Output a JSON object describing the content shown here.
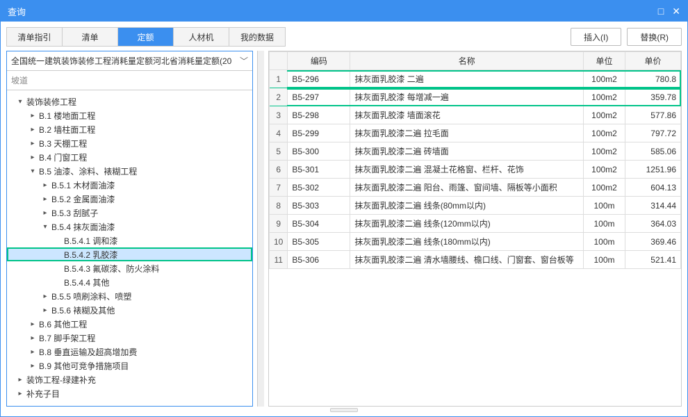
{
  "window": {
    "title": "查询"
  },
  "tabs": [
    "清单指引",
    "清单",
    "定额",
    "人材机",
    "我的数据"
  ],
  "active_tab": 2,
  "buttons": {
    "insert": "插入(I)",
    "replace": "替换(R)"
  },
  "selector": {
    "text": "全国统一建筑装饰装修工程消耗量定额河北省消耗量定额(20"
  },
  "search": {
    "placeholder": "坡道"
  },
  "tree": [
    {
      "depth": 0,
      "toggle": "▾",
      "label": "装饰装修工程"
    },
    {
      "depth": 1,
      "toggle": "▸",
      "label": "B.1 楼地面工程"
    },
    {
      "depth": 1,
      "toggle": "▸",
      "label": "B.2 墙柱面工程"
    },
    {
      "depth": 1,
      "toggle": "▸",
      "label": "B.3 天棚工程"
    },
    {
      "depth": 1,
      "toggle": "▸",
      "label": "B.4 门窗工程"
    },
    {
      "depth": 1,
      "toggle": "▾",
      "label": "B.5 油漆、涂料、裱糊工程"
    },
    {
      "depth": 2,
      "toggle": "▸",
      "label": "B.5.1 木材面油漆"
    },
    {
      "depth": 2,
      "toggle": "▸",
      "label": "B.5.2 金属面油漆"
    },
    {
      "depth": 2,
      "toggle": "▸",
      "label": "B.5.3 刮腻子"
    },
    {
      "depth": 2,
      "toggle": "▾",
      "label": "B.5.4 抹灰面油漆"
    },
    {
      "depth": 3,
      "toggle": "",
      "label": "B.5.4.1 调和漆"
    },
    {
      "depth": 3,
      "toggle": "",
      "label": "B.5.4.2 乳胶漆",
      "selected": true,
      "highlighted": true
    },
    {
      "depth": 3,
      "toggle": "",
      "label": "B.5.4.3 氟碳漆、防火涂料"
    },
    {
      "depth": 3,
      "toggle": "",
      "label": "B.5.4.4 其他"
    },
    {
      "depth": 2,
      "toggle": "▸",
      "label": "B.5.5 喷刷涂料、喷塑"
    },
    {
      "depth": 2,
      "toggle": "▸",
      "label": "B.5.6 裱糊及其他"
    },
    {
      "depth": 1,
      "toggle": "▸",
      "label": "B.6 其他工程"
    },
    {
      "depth": 1,
      "toggle": "▸",
      "label": "B.7 脚手架工程"
    },
    {
      "depth": 1,
      "toggle": "▸",
      "label": "B.8 垂直运输及超高增加费"
    },
    {
      "depth": 1,
      "toggle": "▸",
      "label": "B.9 其他可竞争措施项目"
    },
    {
      "depth": 0,
      "toggle": "▸",
      "label": "装饰工程-绿建补充"
    },
    {
      "depth": 0,
      "toggle": "▸",
      "label": "补充子目"
    }
  ],
  "table": {
    "headers": [
      "",
      "编码",
      "名称",
      "单位",
      "单价"
    ],
    "rows": [
      {
        "n": 1,
        "code": "B5-296",
        "name": "抹灰面乳胶漆 二遍",
        "unit": "100m2",
        "price": "780.8",
        "hl": true
      },
      {
        "n": 2,
        "code": "B5-297",
        "name": "抹灰面乳胶漆 每增减一遍",
        "unit": "100m2",
        "price": "359.78",
        "hl": true
      },
      {
        "n": 3,
        "code": "B5-298",
        "name": "抹灰面乳胶漆 墙面滚花",
        "unit": "100m2",
        "price": "577.86"
      },
      {
        "n": 4,
        "code": "B5-299",
        "name": "抹灰面乳胶漆二遍 拉毛面",
        "unit": "100m2",
        "price": "797.72"
      },
      {
        "n": 5,
        "code": "B5-300",
        "name": "抹灰面乳胶漆二遍 砖墙面",
        "unit": "100m2",
        "price": "585.06"
      },
      {
        "n": 6,
        "code": "B5-301",
        "name": "抹灰面乳胶漆二遍 混凝土花格窗、栏杆、花饰",
        "unit": "100m2",
        "price": "1251.96"
      },
      {
        "n": 7,
        "code": "B5-302",
        "name": "抹灰面乳胶漆二遍 阳台、雨篷、窗间墙、隔板等小面积",
        "unit": "100m2",
        "price": "604.13"
      },
      {
        "n": 8,
        "code": "B5-303",
        "name": "抹灰面乳胶漆二遍 线条(80mm以内)",
        "unit": "100m",
        "price": "314.44"
      },
      {
        "n": 9,
        "code": "B5-304",
        "name": "抹灰面乳胶漆二遍 线条(120mm以内)",
        "unit": "100m",
        "price": "364.03"
      },
      {
        "n": 10,
        "code": "B5-305",
        "name": "抹灰面乳胶漆二遍 线条(180mm以内)",
        "unit": "100m",
        "price": "369.46"
      },
      {
        "n": 11,
        "code": "B5-306",
        "name": "抹灰面乳胶漆二遍 清水墙腰线、檐口线、门窗套、窗台板等",
        "unit": "100m",
        "price": "521.41"
      }
    ]
  }
}
